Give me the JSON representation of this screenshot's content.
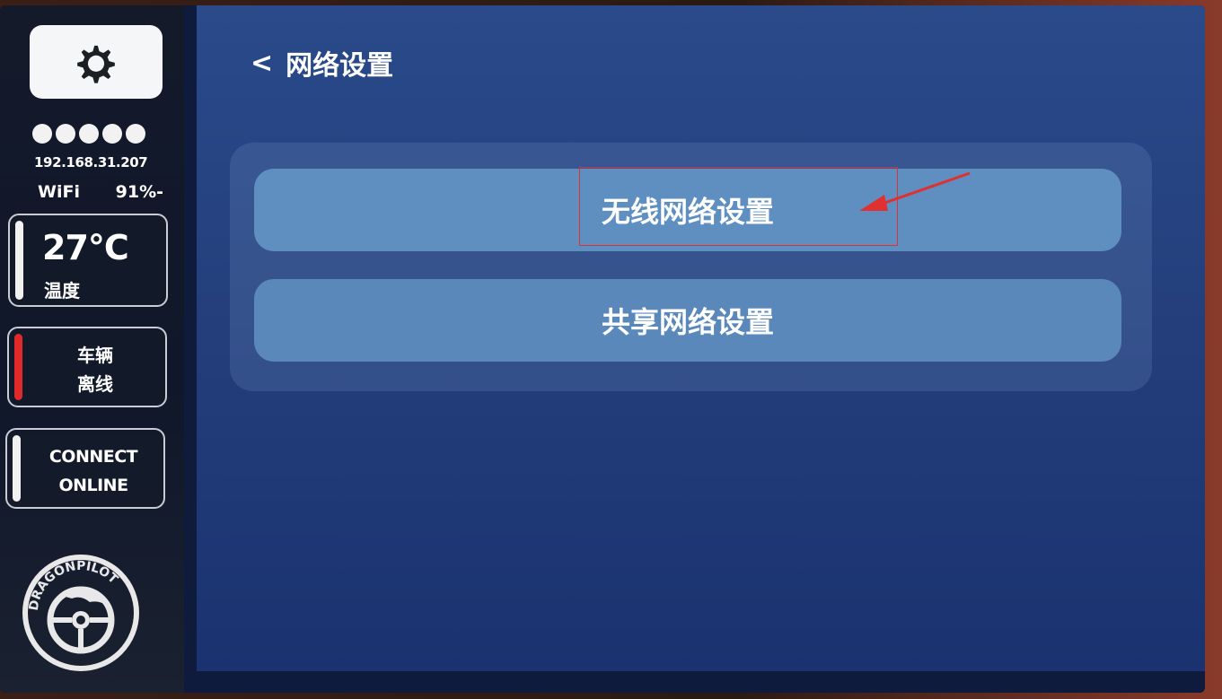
{
  "sidebar": {
    "ip_address": "192.168.31.207",
    "connection_type": "WiFi",
    "signal_percent": "91%-",
    "signal_bars": 5,
    "temperature": {
      "value": "27°C",
      "label": "温度"
    },
    "vehicle": {
      "line1": "车辆",
      "line2": "离线",
      "status_color": "#e02a2a"
    },
    "connect": {
      "line1": "CONNECT",
      "line2": "ONLINE"
    },
    "logo_text": "DRAGONPILOT"
  },
  "header": {
    "back_symbol": "<",
    "title": "网络设置"
  },
  "menu": {
    "items": [
      {
        "label": "无线网络设置"
      },
      {
        "label": "共享网络设置"
      }
    ]
  },
  "annotation": {
    "highlight_color": "#e03030"
  }
}
